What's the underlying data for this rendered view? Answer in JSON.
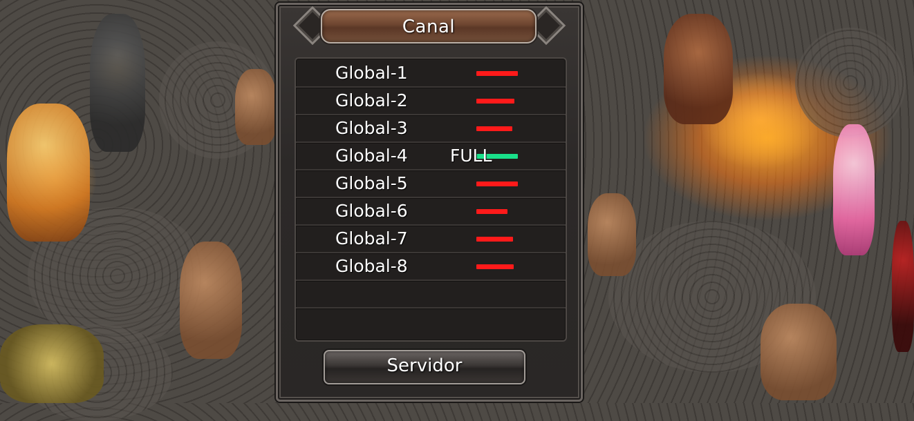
{
  "dialog": {
    "title": "Canal",
    "channels": [
      {
        "name": "Global-1",
        "status": "",
        "load": 0.6,
        "color": "#ff1a1a"
      },
      {
        "name": "Global-2",
        "status": "",
        "load": 0.55,
        "color": "#ff1a1a"
      },
      {
        "name": "Global-3",
        "status": "",
        "load": 0.52,
        "color": "#ff1a1a"
      },
      {
        "name": "Global-4",
        "status": "FULL",
        "load": 0.6,
        "color": "#19e08a"
      },
      {
        "name": "Global-5",
        "status": "",
        "load": 0.6,
        "color": "#ff1a1a"
      },
      {
        "name": "Global-6",
        "status": "",
        "load": 0.45,
        "color": "#ff1a1a"
      },
      {
        "name": "Global-7",
        "status": "",
        "load": 0.53,
        "color": "#ff1a1a"
      },
      {
        "name": "Global-8",
        "status": "",
        "load": 0.54,
        "color": "#ff1a1a"
      }
    ],
    "server_button_label": "Servidor"
  }
}
